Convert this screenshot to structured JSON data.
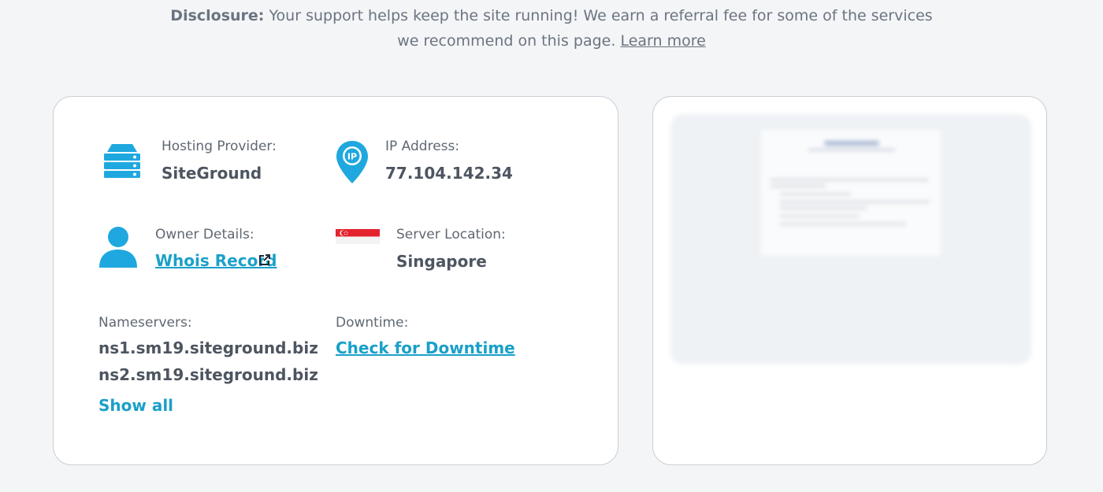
{
  "disclosure": {
    "bold": "Disclosure:",
    "line1": "Your support helps keep the site running! We earn a referral fee for some of the services",
    "line2": "we recommend on this page.",
    "learn_more": "Learn more"
  },
  "details": {
    "hosting": {
      "label": "Hosting Provider:",
      "value": "SiteGround",
      "icon": "server-icon"
    },
    "ip": {
      "label": "IP Address:",
      "value": "77.104.142.34",
      "icon": "ip-pin-icon"
    },
    "owner": {
      "label": "Owner Details:",
      "link": "Whois Record",
      "icon": "user-icon"
    },
    "location": {
      "label": "Server Location:",
      "value": "Singapore",
      "icon": "singapore-flag-icon"
    },
    "nameservers": {
      "label": "Nameservers:",
      "items": [
        "ns1.sm19.siteground.biz",
        "ns2.sm19.siteground.biz"
      ],
      "show_all": "Show all"
    },
    "downtime": {
      "label": "Downtime:",
      "link": "Check for Downtime"
    },
    "ip_badge": "IP"
  },
  "colors": {
    "accent": "#1aa0c9",
    "icon_blue": "#1fa8df",
    "flag_red": "#e4232f"
  }
}
